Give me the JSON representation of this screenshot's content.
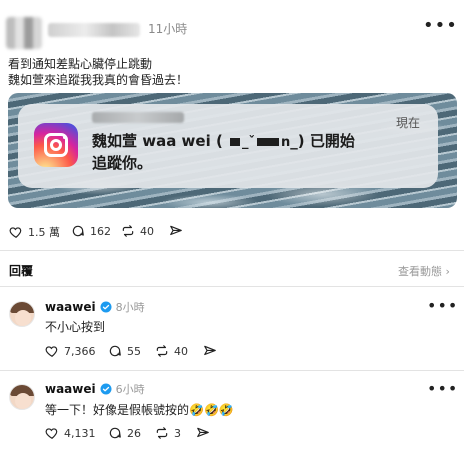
{
  "post": {
    "time": "11小時",
    "text_line1": "看到通知差點心臟停止跳動",
    "text_line2": "魏如萱來追蹤我我真的會昏過去！",
    "notification": {
      "message_prefix": "魏如萱 waa wei (",
      "message_suffix": "_) 已開始追蹤你。",
      "time": "現在"
    },
    "actions": {
      "likes": "1.5 萬",
      "comments": "162",
      "reposts": "40"
    }
  },
  "replies_header": {
    "label": "回覆",
    "view_activity": "查看動態 ›"
  },
  "comments": [
    {
      "name": "waawei",
      "time": "8小時",
      "text": "不小心按到",
      "likes": "7,366",
      "comments": "55",
      "reposts": "40"
    },
    {
      "name": "waawei",
      "time": "6小時",
      "text": "等一下！好像是假帳號按的🤣🤣🤣",
      "likes": "4,131",
      "comments": "26",
      "reposts": "3"
    }
  ],
  "colors": {
    "verified": "#1d9bf0",
    "muted_text": "#999999",
    "divider": "#e3e3e3"
  },
  "icons": [
    "more-icon",
    "instagram-icon",
    "heart-icon",
    "comment-icon",
    "repost-icon",
    "share-icon",
    "verified-icon"
  ]
}
